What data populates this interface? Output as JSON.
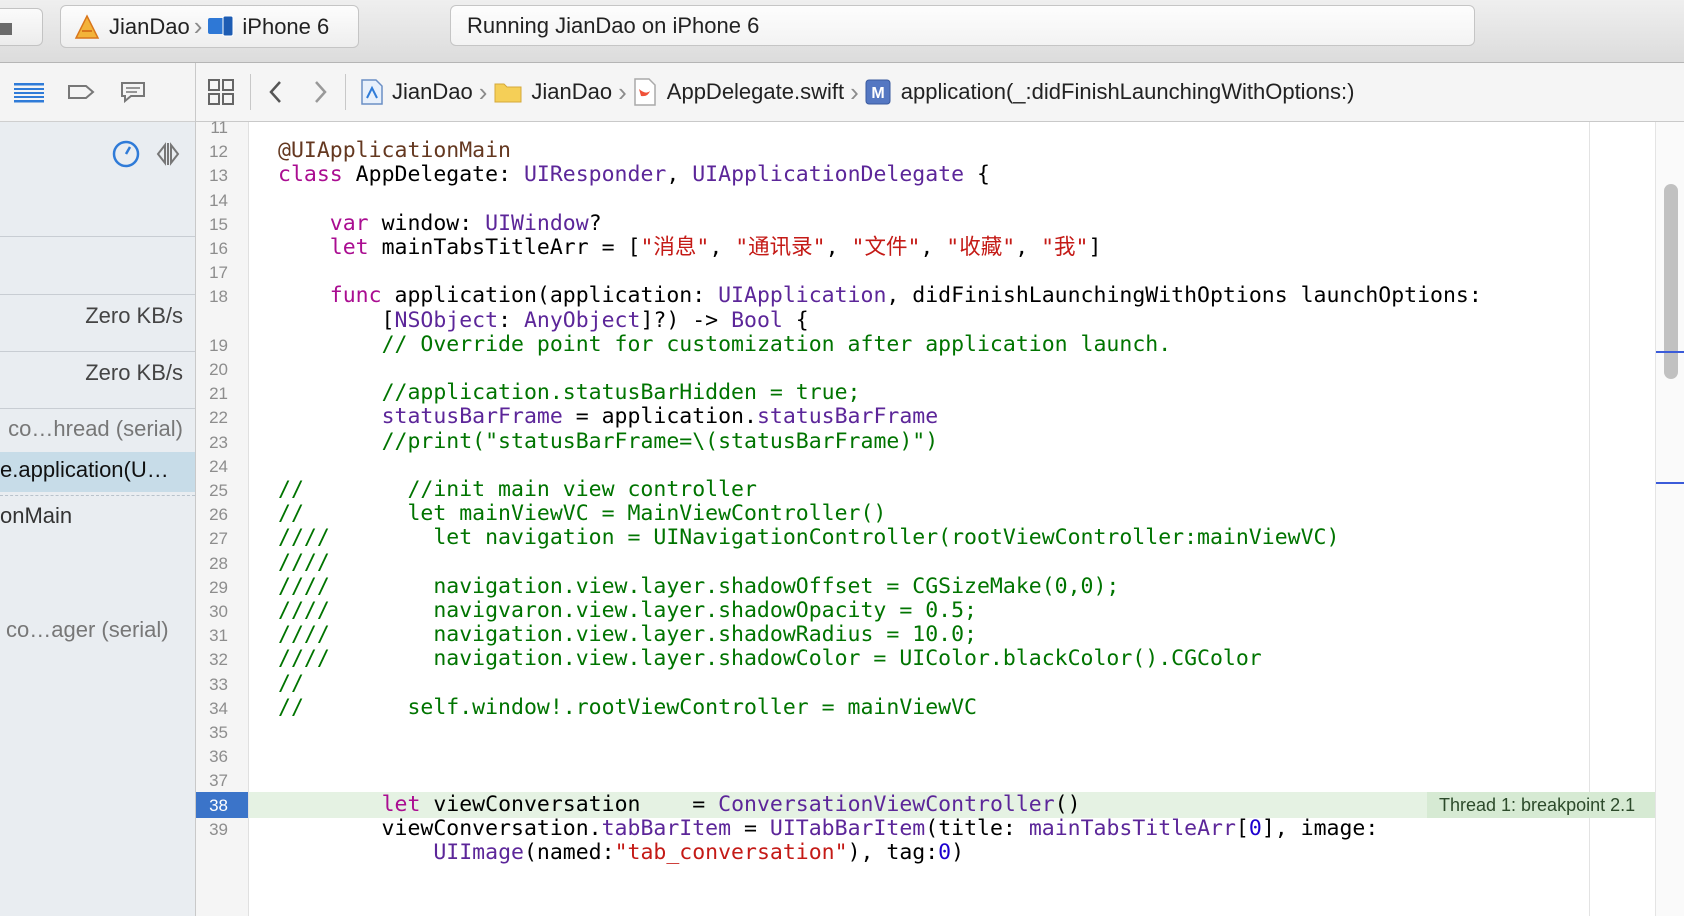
{
  "toolbar": {
    "scheme": "JianDao",
    "device": "iPhone 6",
    "status": "Running JianDao on iPhone 6"
  },
  "sidebar": {
    "rows": [
      {
        "text": "Zero KB/s"
      },
      {
        "text": "Zero KB/s"
      },
      {
        "text": "co…hread (serial)"
      },
      {
        "text": "e.application(U…"
      },
      {
        "text": "onMain"
      },
      {
        "text": "co…ager (serial)"
      }
    ]
  },
  "jumpbar": {
    "project": "JianDao",
    "group": "JianDao",
    "file": "AppDelegate.swift",
    "method": "application(_:didFinishLaunchingWithOptions:)"
  },
  "editor": {
    "lines": [
      {
        "n": "11",
        "html": ""
      },
      {
        "n": "12",
        "html": "<span class='at'>@UIApplicationMain</span>"
      },
      {
        "n": "13",
        "html": "<span class='kw'>class</span> AppDelegate: <span class='ty'>UIResponder</span>, <span class='ty'>UIApplicationDelegate</span> {"
      },
      {
        "n": "14",
        "html": ""
      },
      {
        "n": "15",
        "html": "    <span class='kw'>var</span> window: <span class='ty'>UIWindow</span>?"
      },
      {
        "n": "16",
        "html": "    <span class='kw'>let</span> mainTabsTitleArr = [<span class='st'>\"消息\"</span>, <span class='st'>\"通讯录\"</span>, <span class='st'>\"文件\"</span>, <span class='st'>\"收藏\"</span>, <span class='st'>\"我\"</span>]"
      },
      {
        "n": "17",
        "html": ""
      },
      {
        "n": "18",
        "html": "    <span class='kw'>func</span> application(application: <span class='ty'>UIApplication</span>, didFinishLaunchingWithOptions launchOptions:"
      },
      {
        "n": "",
        "html": "        [<span class='ty'>NSObject</span>: <span class='ty'>AnyObject</span>]?) -> <span class='ty'>Bool</span> {"
      },
      {
        "n": "19",
        "html": "        <span class='cm'>// Override point for customization after application launch.</span>"
      },
      {
        "n": "20",
        "html": ""
      },
      {
        "n": "21",
        "html": "        <span class='cm'>//application.statusBarHidden = true;</span>"
      },
      {
        "n": "22",
        "html": "        <span class='ty'>statusBarFrame</span> = application.<span class='ty'>statusBarFrame</span>"
      },
      {
        "n": "23",
        "html": "        <span class='cm'>//print(\"statusBarFrame=\\(statusBarFrame)\")</span>"
      },
      {
        "n": "24",
        "html": ""
      },
      {
        "n": "25",
        "html": "<span class='cm'>//        //init main view controller</span>"
      },
      {
        "n": "26",
        "html": "<span class='cm'>//        let mainViewVC = MainViewController()</span>"
      },
      {
        "n": "27",
        "html": "<span class='cm'>////        let navigation = UINavigationController(rootViewController:mainViewVC)</span>"
      },
      {
        "n": "28",
        "html": "<span class='cm'>////</span>"
      },
      {
        "n": "29",
        "html": "<span class='cm'>////        navigation.view.layer.shadowOffset = CGSizeMake(0,0);</span>"
      },
      {
        "n": "30",
        "html": "<span class='cm'>////        navigvaron.view.layer.shadowOpacity = 0.5;</span>"
      },
      {
        "n": "31",
        "html": "<span class='cm'>////        navigation.view.layer.shadowRadius = 10.0;</span>"
      },
      {
        "n": "32",
        "html": "<span class='cm'>////        navigation.view.layer.shadowColor = UIColor.blackColor().CGColor</span>"
      },
      {
        "n": "33",
        "html": "<span class='cm'>//</span>"
      },
      {
        "n": "34",
        "html": "<span class='cm'>//        self.window!.rootViewController = mainViewVC</span>"
      },
      {
        "n": "35",
        "html": ""
      },
      {
        "n": "36",
        "html": ""
      },
      {
        "n": "37",
        "html": ""
      },
      {
        "n": "38",
        "html": "        <span class='kw'>let</span> viewConversation    = <span class='ty'>ConversationViewController</span>()"
      },
      {
        "n": "39",
        "html": "        viewConversation.<span class='ty'>tabBarItem</span> = <span class='ty'>UITabBarItem</span>(title: <span class='ty'>mainTabsTitleArr</span>[<span class='nm'>0</span>], image:"
      },
      {
        "n": "",
        "html": "            <span class='ty'>UIImage</span>(named:<span class='st'>\"tab_conversation\"</span>), tag:<span class='nm'>0</span>)"
      }
    ],
    "breakpoint_label": "Thread 1: breakpoint 2.1",
    "current_line": "38"
  },
  "colors": {
    "keyword": "#aa0d91",
    "type": "#5c2699",
    "comment": "#007400",
    "string": "#c41a16",
    "breakpoint": "#3b74c9"
  }
}
